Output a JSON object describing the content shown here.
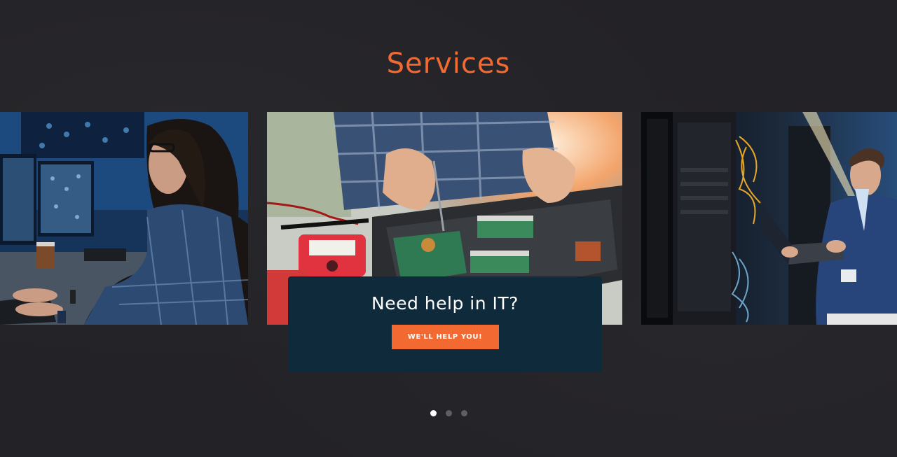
{
  "section": {
    "title": "Services"
  },
  "slides": [
    {
      "name": "IT specialist at computer monitors"
    },
    {
      "name": "Technician repairing laptop motherboard"
    },
    {
      "name": "Engineer with laptop in server room"
    }
  ],
  "cta": {
    "heading": "Need help in IT?",
    "button_label": "WE'LL HELP YOU!"
  },
  "carousel": {
    "active_index": 0,
    "dot_count": 3
  },
  "colors": {
    "background": "#232226",
    "accent": "#f26a32",
    "card": "#0f2a3a",
    "dot_active": "#ffffff",
    "dot_inactive": "#5e5e63"
  }
}
